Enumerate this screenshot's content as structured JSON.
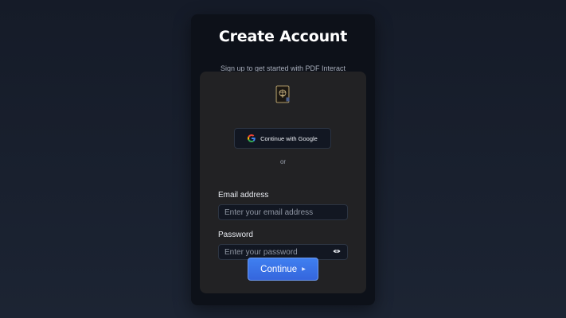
{
  "header": {
    "title": "Create Account",
    "subtitle": "Sign up to get started with PDF Interact"
  },
  "logo": {
    "icon": "app-logo-icon"
  },
  "google": {
    "label": "Continue with Google",
    "icon": "google-icon"
  },
  "divider": {
    "text": "or"
  },
  "email": {
    "label": "Email address",
    "placeholder": "Enter your email address",
    "value": ""
  },
  "password": {
    "label": "Password",
    "placeholder": "Enter your password",
    "value": "",
    "toggle_icon": "eye-icon"
  },
  "submit": {
    "label": "Continue",
    "icon": "caret-right-icon"
  },
  "colors": {
    "background": "#151b28",
    "card": "#0d1119",
    "panel": "#222224",
    "accent": "#3f7ff0"
  }
}
